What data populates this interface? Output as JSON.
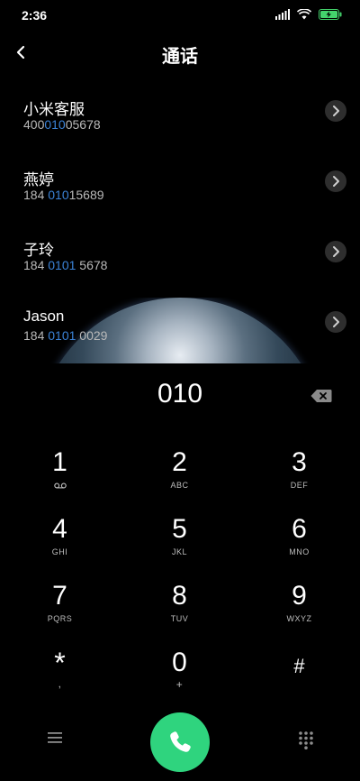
{
  "statusbar": {
    "time": "2:36",
    "battery_color": "#44d36c"
  },
  "header": {
    "title": "通话"
  },
  "contacts": [
    {
      "name": "小米客服",
      "num_pre": "400",
      "num_hl": "010",
      "num_post": "05678"
    },
    {
      "name": "燕婷",
      "num_pre": "184 ",
      "num_hl": "010",
      "num_post": "15689"
    },
    {
      "name": "子玲",
      "num_pre": "184 ",
      "num_hl": "0101",
      "num_post": " 5678"
    },
    {
      "name": "Jason",
      "num_pre": "184 ",
      "num_hl": "0101",
      "num_post": " 0029"
    }
  ],
  "dialer": {
    "input": "010"
  },
  "keys": [
    {
      "digit": "1",
      "sub": "voicemail"
    },
    {
      "digit": "2",
      "sub": "ABC"
    },
    {
      "digit": "3",
      "sub": "DEF"
    },
    {
      "digit": "4",
      "sub": "GHI"
    },
    {
      "digit": "5",
      "sub": "JKL"
    },
    {
      "digit": "6",
      "sub": "MNO"
    },
    {
      "digit": "7",
      "sub": "PQRS"
    },
    {
      "digit": "8",
      "sub": "TUV"
    },
    {
      "digit": "9",
      "sub": "WXYZ"
    },
    {
      "digit": "*",
      "sub": ","
    },
    {
      "digit": "0",
      "sub": "+"
    },
    {
      "digit": "#",
      "sub": ""
    }
  ],
  "colors": {
    "accent": "#3b82d6",
    "call": "#2fd47e"
  },
  "icons": {
    "back": "back-chevron-icon",
    "contact_action": "chevron-right-icon",
    "backspace": "backspace-icon",
    "menu": "menu-icon",
    "call": "phone-icon",
    "dialpad": "dialpad-icon"
  }
}
